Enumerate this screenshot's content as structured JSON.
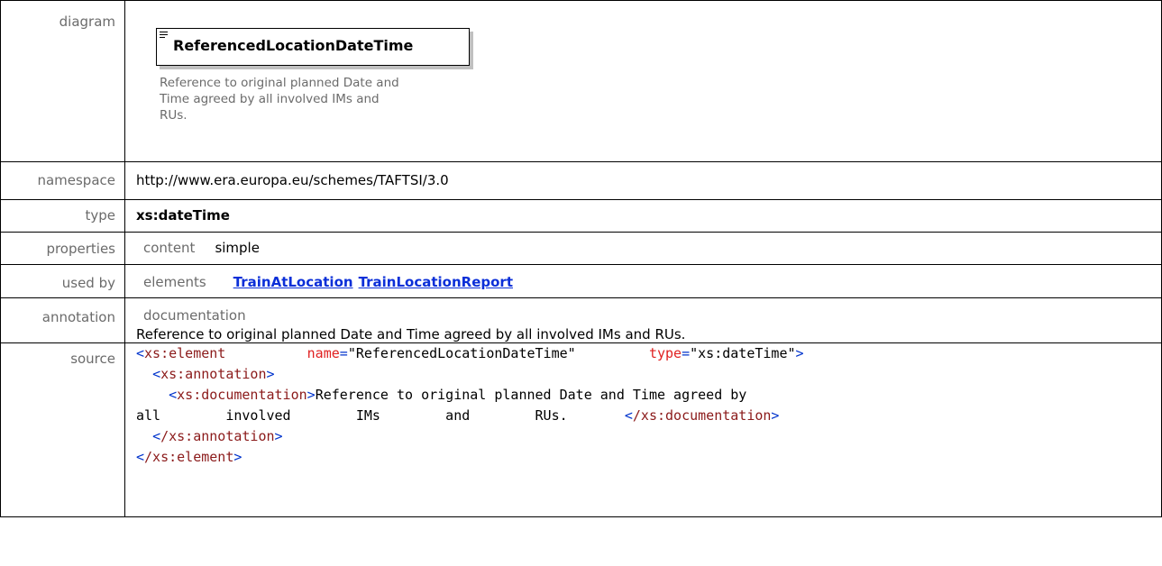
{
  "labels": {
    "diagram": "diagram",
    "namespace": "namespace",
    "type": "type",
    "properties": "properties",
    "used_by": "used by",
    "annotation": "annotation",
    "source": "source"
  },
  "diagram": {
    "element_name": "ReferencedLocationDateTime",
    "doc_lines": [
      "Reference to original planned Date and",
      "Time agreed by all involved IMs and",
      "RUs."
    ],
    "icon": "element-lines-icon"
  },
  "namespace": "http://www.era.europa.eu/schemes/TAFTSI/3.0",
  "type": "xs:dateTime",
  "properties": {
    "label": "content",
    "value": "simple"
  },
  "used_by": {
    "label": "elements",
    "links": [
      "TrainAtLocation",
      "TrainLocationReport"
    ]
  },
  "annotation": {
    "label": "documentation",
    "text": "Reference to original planned Date and Time agreed by all involved IMs and RUs."
  },
  "source": {
    "l1_open": "<",
    "l1_tag": "xs:element",
    "l1_attr1": "name",
    "l1_eq": "=",
    "l1_val1": "\"ReferencedLocationDateTime\"",
    "l1_attr2": "type",
    "l1_val2": "\"xs:dateTime\"",
    "l1_close": ">",
    "l2_tag": "xs:annotation",
    "l3_tag": "xs:documentation",
    "l3_text": "Reference to original planned Date and Time agreed by",
    "l4_text": "all        involved        IMs        and        RUs.",
    "l4_close_tag": "/xs:documentation",
    "l5_close_tag": "/xs:annotation",
    "l6_close_tag": "/xs:element"
  },
  "colors": {
    "tag": "#0033cc",
    "tag_name": "#8b1a1a",
    "attr_name": "#e02020",
    "link": "#0b2fd8",
    "label_gray": "#6b6b6b"
  }
}
